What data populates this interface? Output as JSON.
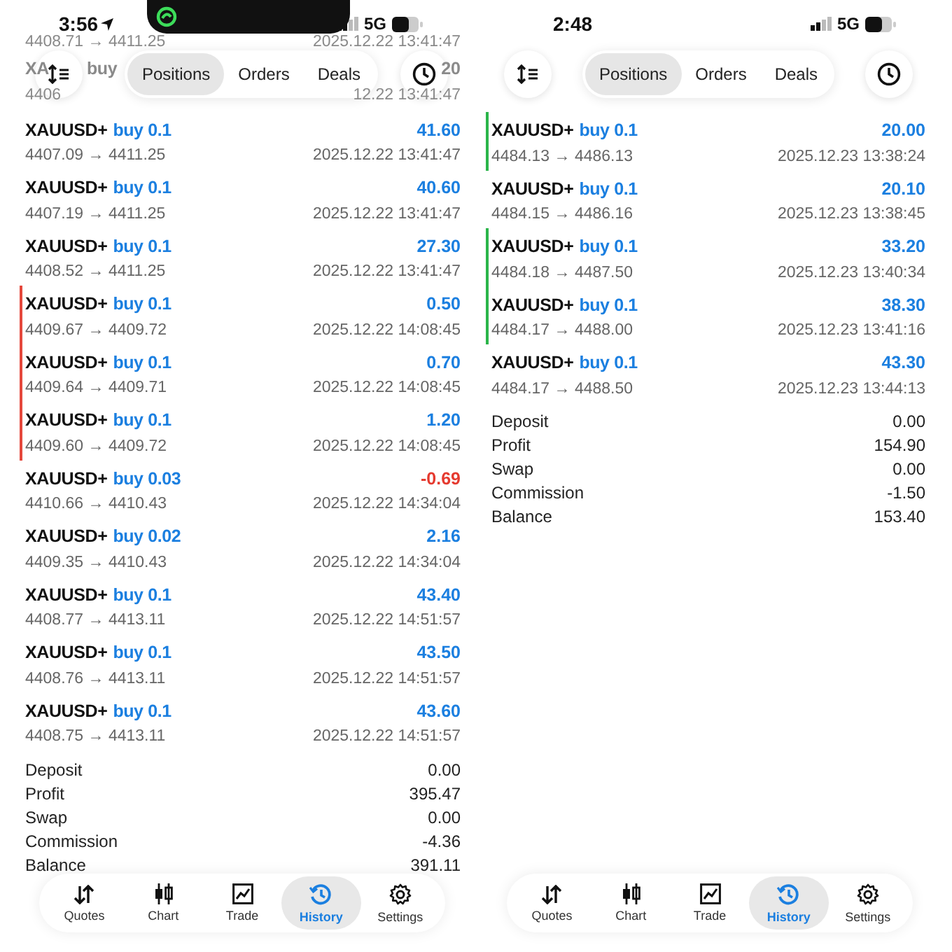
{
  "panels": [
    {
      "status": {
        "time": "3:56",
        "network": "5G",
        "location": true,
        "island": true
      },
      "tabs": [
        {
          "label": "Positions",
          "selected": true
        },
        {
          "label": "Orders",
          "selected": false
        },
        {
          "label": "Deals",
          "selected": false
        }
      ],
      "covered_rows": [
        {
          "prices": "4408.71 → 4411.25",
          "date": "2025.12.22 13:41:47"
        },
        {
          "symbol": "XA",
          "side": "buy",
          "profit": "20",
          "prices": "4406",
          "date": "12.22 13:41:47"
        }
      ],
      "rows": [
        {
          "symbol": "XAUUSD+",
          "side": "buy 0.1",
          "profit": "41.60",
          "loss": false,
          "prices": "4407.09 → 4411.25",
          "date": "2025.12.22 13:41:47"
        },
        {
          "symbol": "XAUUSD+",
          "side": "buy 0.1",
          "profit": "40.60",
          "loss": false,
          "prices": "4407.19 → 4411.25",
          "date": "2025.12.22 13:41:47"
        },
        {
          "symbol": "XAUUSD+",
          "side": "buy 0.1",
          "profit": "27.30",
          "loss": false,
          "prices": "4408.52 → 4411.25",
          "date": "2025.12.22 13:41:47"
        },
        {
          "symbol": "XAUUSD+",
          "side": "buy 0.1",
          "profit": "0.50",
          "loss": false,
          "prices": "4409.67 → 4409.72",
          "date": "2025.12.22 14:08:45",
          "color": "#e5483c"
        },
        {
          "symbol": "XAUUSD+",
          "side": "buy 0.1",
          "profit": "0.70",
          "loss": false,
          "prices": "4409.64 → 4409.71",
          "date": "2025.12.22 14:08:45",
          "color": "#e5483c"
        },
        {
          "symbol": "XAUUSD+",
          "side": "buy 0.1",
          "profit": "1.20",
          "loss": false,
          "prices": "4409.60 → 4409.72",
          "date": "2025.12.22 14:08:45",
          "color": "#e5483c"
        },
        {
          "symbol": "XAUUSD+",
          "side": "buy 0.03",
          "profit": "-0.69",
          "loss": true,
          "prices": "4410.66 → 4410.43",
          "date": "2025.12.22 14:34:04"
        },
        {
          "symbol": "XAUUSD+",
          "side": "buy 0.02",
          "profit": "2.16",
          "loss": false,
          "prices": "4409.35 → 4410.43",
          "date": "2025.12.22 14:34:04"
        },
        {
          "symbol": "XAUUSD+",
          "side": "buy 0.1",
          "profit": "43.40",
          "loss": false,
          "prices": "4408.77 → 4413.11",
          "date": "2025.12.22 14:51:57"
        },
        {
          "symbol": "XAUUSD+",
          "side": "buy 0.1",
          "profit": "43.50",
          "loss": false,
          "prices": "4408.76 → 4413.11",
          "date": "2025.12.22 14:51:57"
        },
        {
          "symbol": "XAUUSD+",
          "side": "buy 0.1",
          "profit": "43.60",
          "loss": false,
          "prices": "4408.75 → 4413.11",
          "date": "2025.12.22 14:51:57"
        }
      ],
      "summary": [
        {
          "label": "Deposit",
          "value": "0.00"
        },
        {
          "label": "Profit",
          "value": "395.47"
        },
        {
          "label": "Swap",
          "value": "0.00"
        },
        {
          "label": "Commission",
          "value": "-4.36"
        },
        {
          "label": "Balance",
          "value": "391.11"
        }
      ],
      "nav": [
        {
          "label": "Quotes",
          "selected": false
        },
        {
          "label": "Chart",
          "selected": false
        },
        {
          "label": "Trade",
          "selected": false
        },
        {
          "label": "History",
          "selected": true
        },
        {
          "label": "Settings",
          "selected": false
        }
      ]
    },
    {
      "status": {
        "time": "2:48",
        "network": "5G",
        "location": false,
        "island": false
      },
      "tabs": [
        {
          "label": "Positions",
          "selected": true
        },
        {
          "label": "Orders",
          "selected": false
        },
        {
          "label": "Deals",
          "selected": false
        }
      ],
      "rows": [
        {
          "symbol": "XAUUSD+",
          "side": "buy 0.1",
          "profit": "20.00",
          "loss": false,
          "prices": "4484.13 → 4486.13",
          "date": "2025.12.23 13:38:24",
          "color": "#2bb54a"
        },
        {
          "symbol": "XAUUSD+",
          "side": "buy 0.1",
          "profit": "20.10",
          "loss": false,
          "prices": "4484.15 → 4486.16",
          "date": "2025.12.23 13:38:45"
        },
        {
          "symbol": "XAUUSD+",
          "side": "buy 0.1",
          "profit": "33.20",
          "loss": false,
          "prices": "4484.18 → 4487.50",
          "date": "2025.12.23 13:40:34",
          "color": "#2bb54a"
        },
        {
          "symbol": "XAUUSD+",
          "side": "buy 0.1",
          "profit": "38.30",
          "loss": false,
          "prices": "4484.17 → 4488.00",
          "date": "2025.12.23 13:41:16",
          "color": "#2bb54a"
        },
        {
          "symbol": "XAUUSD+",
          "side": "buy 0.1",
          "profit": "43.30",
          "loss": false,
          "prices": "4484.17 → 4488.50",
          "date": "2025.12.23 13:44:13"
        }
      ],
      "summary": [
        {
          "label": "Deposit",
          "value": "0.00"
        },
        {
          "label": "Profit",
          "value": "154.90"
        },
        {
          "label": "Swap",
          "value": "0.00"
        },
        {
          "label": "Commission",
          "value": "-1.50"
        },
        {
          "label": "Balance",
          "value": "153.40"
        }
      ],
      "nav": [
        {
          "label": "Quotes",
          "selected": false
        },
        {
          "label": "Chart",
          "selected": false
        },
        {
          "label": "Trade",
          "selected": false
        },
        {
          "label": "History",
          "selected": true
        },
        {
          "label": "Settings",
          "selected": false
        }
      ]
    }
  ]
}
